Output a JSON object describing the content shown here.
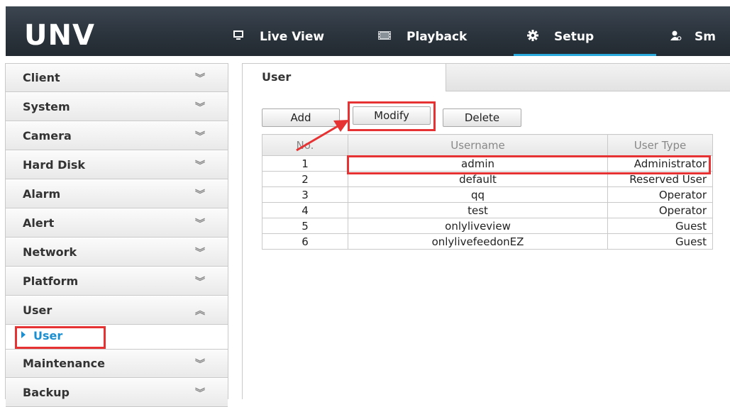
{
  "header": {
    "logo": "UNV",
    "nav": [
      {
        "label": "Live View",
        "icon": "monitor-icon"
      },
      {
        "label": "Playback",
        "icon": "film-icon"
      },
      {
        "label": "Setup",
        "icon": "gear-icon"
      },
      {
        "label": "Sm",
        "icon": "user-search-icon"
      }
    ]
  },
  "sidebar": {
    "items": [
      {
        "label": "Client",
        "expanded": false
      },
      {
        "label": "System",
        "expanded": false
      },
      {
        "label": "Camera",
        "expanded": false
      },
      {
        "label": "Hard Disk",
        "expanded": false
      },
      {
        "label": "Alarm",
        "expanded": false
      },
      {
        "label": "Alert",
        "expanded": false
      },
      {
        "label": "Network",
        "expanded": false
      },
      {
        "label": "Platform",
        "expanded": false
      },
      {
        "label": "User",
        "expanded": true
      },
      {
        "label": "Maintenance",
        "expanded": false
      },
      {
        "label": "Backup",
        "expanded": false
      }
    ],
    "sub_item": "User"
  },
  "main": {
    "tab": "User",
    "buttons": {
      "add": "Add",
      "modify": "Modify",
      "delete": "Delete"
    },
    "table": {
      "headers": [
        "No.",
        "Username",
        "User Type"
      ],
      "rows": [
        [
          "1",
          "admin",
          "Administrator"
        ],
        [
          "2",
          "default",
          "Reserved User"
        ],
        [
          "3",
          "qq",
          "Operator"
        ],
        [
          "4",
          "test",
          "Operator"
        ],
        [
          "5",
          "onlyliveview",
          "Guest"
        ],
        [
          "6",
          "onlylivefeedonEZ",
          "Guest"
        ]
      ]
    }
  },
  "colors": {
    "nav_bg": "#2a323b",
    "accent": "#2aa9dd",
    "highlight": "#e63232",
    "sub_item_text": "#1b8fd0"
  }
}
